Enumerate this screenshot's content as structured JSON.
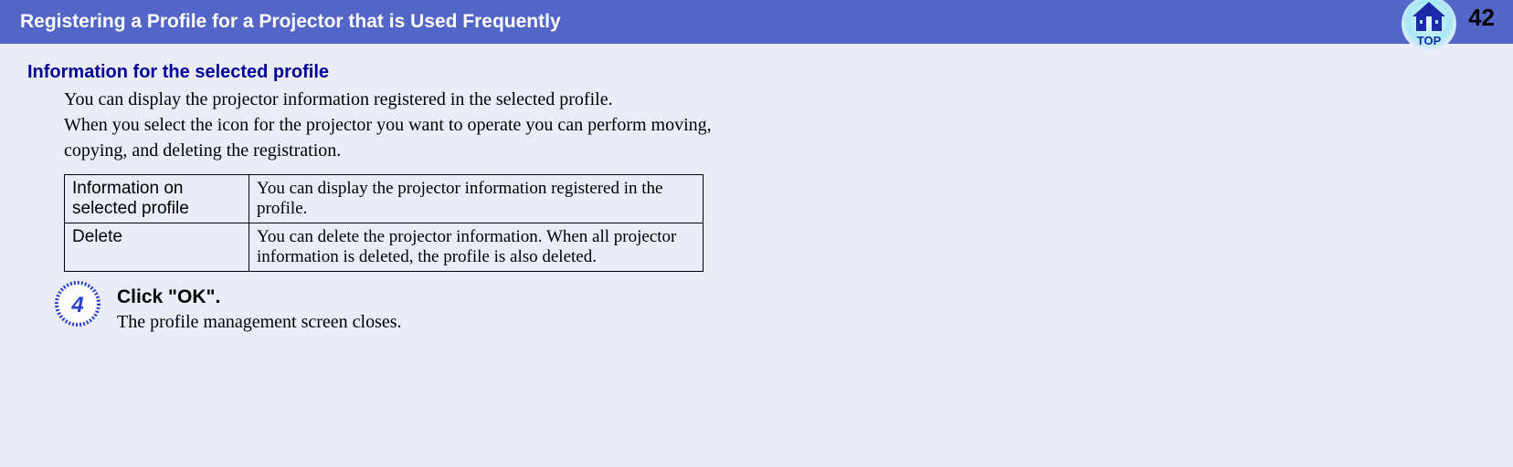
{
  "header": {
    "title": "Registering a Profile for a Projector that is Used Frequently",
    "page_number": "42",
    "top_label": "TOP"
  },
  "section": {
    "heading": "Information for the selected profile",
    "para1": "You can display the projector information registered in the selected profile.",
    "para2": "When you select the icon for the projector you want to operate you can perform moving, copying, and deleting the registration."
  },
  "table": {
    "rows": [
      {
        "label": "Information on selected profile",
        "desc": "You can display the projector information registered in the profile."
      },
      {
        "label": "Delete",
        "desc": "You can delete the projector information. When all projector information is deleted, the profile is also deleted."
      }
    ]
  },
  "step": {
    "number": "4",
    "title": "Click \"OK\".",
    "desc": "The profile management screen closes."
  }
}
